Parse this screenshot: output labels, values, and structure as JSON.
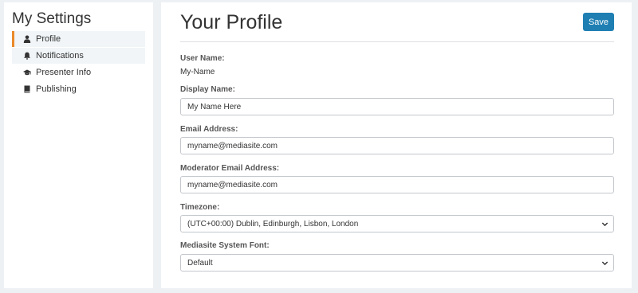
{
  "sidebar": {
    "title": "My Settings",
    "items": [
      {
        "label": "Profile",
        "icon": "user-icon"
      },
      {
        "label": "Notifications",
        "icon": "bell-icon"
      },
      {
        "label": "Presenter Info",
        "icon": "graduation-cap-icon"
      },
      {
        "label": "Publishing",
        "icon": "book-icon"
      }
    ]
  },
  "main": {
    "title": "Your Profile",
    "save_label": "Save",
    "fields": {
      "user_name": {
        "label": "User Name:",
        "value": "My-Name"
      },
      "display_name": {
        "label": "Display Name:",
        "value": "My Name Here"
      },
      "email": {
        "label": "Email Address:",
        "value": "myname@mediasite.com"
      },
      "moderator_email": {
        "label": "Moderator Email Address:",
        "value": "myname@mediasite.com"
      },
      "timezone": {
        "label": "Timezone:",
        "value": "(UTC+00:00) Dublin, Edinburgh, Lisbon, London"
      },
      "system_font": {
        "label": "Mediasite System Font:",
        "value": "Default"
      }
    }
  },
  "colors": {
    "accent": "#e98a2a",
    "button": "#1f7fb3",
    "background": "#eef1f4"
  }
}
